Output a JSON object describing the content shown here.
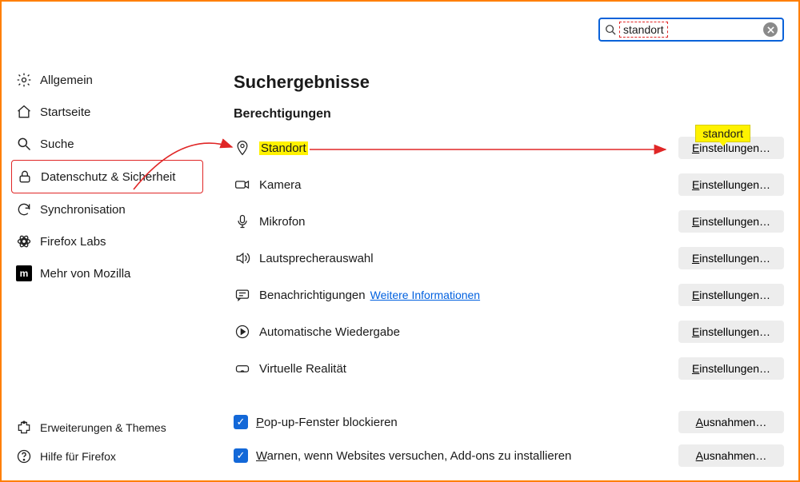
{
  "search": {
    "value": "standort",
    "placeholder": ""
  },
  "sidebar": {
    "items": [
      {
        "label": "Allgemein"
      },
      {
        "label": "Startseite"
      },
      {
        "label": "Suche"
      },
      {
        "label": "Datenschutz & Sicherheit"
      },
      {
        "label": "Synchronisation"
      },
      {
        "label": "Firefox Labs"
      },
      {
        "label": "Mehr von Mozilla"
      }
    ],
    "bottom": [
      {
        "label": "Erweiterungen & Themes"
      },
      {
        "label": "Hilfe für Firefox"
      }
    ]
  },
  "main": {
    "heading": "Suchergebnisse",
    "section": "Berechtigungen",
    "permissions": [
      {
        "label": "Standort"
      },
      {
        "label": "Kamera"
      },
      {
        "label": "Mikrofon"
      },
      {
        "label": "Lautsprecherauswahl"
      },
      {
        "label": "Benachrichtigungen",
        "link": "Weitere Informationen"
      },
      {
        "label": "Automatische Wiedergabe"
      },
      {
        "label": "Virtuelle Realität"
      }
    ],
    "settings_btn_prefix": "E",
    "settings_btn_rest": "instellungen…",
    "exceptions_btn_prefix": "A",
    "exceptions_btn_rest": "usnahmen…",
    "check_popup_prefix": "P",
    "check_popup_rest": "op-up-Fenster blockieren",
    "check_warn_prefix": "W",
    "check_warn_rest": "arnen, wenn Websites versuchen, Add-ons zu installieren"
  },
  "tooltip": "standort"
}
